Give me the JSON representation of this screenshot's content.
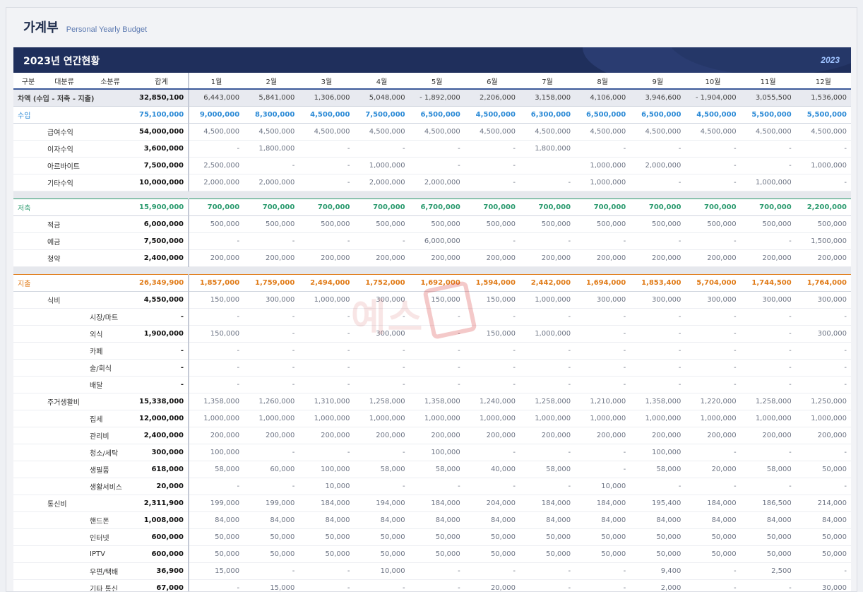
{
  "title": "가계부",
  "subtitle": "Personal Yearly Budget",
  "banner": {
    "title": "2023년 연간현황",
    "year": "2023"
  },
  "watermark": "예스",
  "colors": {
    "banner": "#1f2f5c",
    "income": "#2b8ad6",
    "saving": "#2a9a6e",
    "expense": "#e07b18"
  },
  "headers": [
    "구분",
    "대분류",
    "소분류",
    "합계",
    "1월",
    "2월",
    "3월",
    "4월",
    "5월",
    "6월",
    "7월",
    "8월",
    "9월",
    "10월",
    "11월",
    "12월"
  ],
  "rows": [
    {
      "kind": "balance",
      "l1": "차액 (수입 - 저축 - 지출)",
      "l2": "",
      "l3": "",
      "total": "32,850,100",
      "months": [
        "6,443,000",
        "5,841,000",
        "1,306,000",
        "5,048,000",
        "- 1,892,000",
        "2,206,000",
        "3,158,000",
        "4,106,000",
        "3,946,600",
        "- 1,904,000",
        "3,055,500",
        "1,536,000"
      ]
    },
    {
      "kind": "sec-income",
      "l1": "수입",
      "l2": "",
      "l3": "",
      "total": "75,100,000",
      "months": [
        "9,000,000",
        "8,300,000",
        "4,500,000",
        "7,500,000",
        "6,500,000",
        "4,500,000",
        "6,300,000",
        "6,500,000",
        "6,500,000",
        "4,500,000",
        "5,500,000",
        "5,500,000"
      ]
    },
    {
      "kind": "item",
      "l1": "",
      "l2": "급여수익",
      "l3": "",
      "total": "54,000,000",
      "months": [
        "4,500,000",
        "4,500,000",
        "4,500,000",
        "4,500,000",
        "4,500,000",
        "4,500,000",
        "4,500,000",
        "4,500,000",
        "4,500,000",
        "4,500,000",
        "4,500,000",
        "4,500,000"
      ]
    },
    {
      "kind": "item",
      "l1": "",
      "l2": "이자수익",
      "l3": "",
      "total": "3,600,000",
      "months": [
        "-",
        "1,800,000",
        "-",
        "-",
        "-",
        "-",
        "1,800,000",
        "-",
        "-",
        "-",
        "-",
        "-"
      ]
    },
    {
      "kind": "item",
      "l1": "",
      "l2": "아르바이트",
      "l3": "",
      "total": "7,500,000",
      "months": [
        "2,500,000",
        "-",
        "-",
        "1,000,000",
        "-",
        "-",
        "",
        "1,000,000",
        "2,000,000",
        "-",
        "-",
        "1,000,000"
      ]
    },
    {
      "kind": "item",
      "l1": "",
      "l2": "기타수익",
      "l3": "",
      "total": "10,000,000",
      "months": [
        "2,000,000",
        "2,000,000",
        "-",
        "2,000,000",
        "2,000,000",
        "-",
        "-",
        "1,000,000",
        "-",
        "-",
        "1,000,000",
        "-"
      ]
    },
    {
      "kind": "gap"
    },
    {
      "kind": "sec-saving",
      "l1": "저축",
      "l2": "",
      "l3": "",
      "total": "15,900,000",
      "months": [
        "700,000",
        "700,000",
        "700,000",
        "700,000",
        "6,700,000",
        "700,000",
        "700,000",
        "700,000",
        "700,000",
        "700,000",
        "700,000",
        "2,200,000"
      ]
    },
    {
      "kind": "item",
      "l1": "",
      "l2": "적금",
      "l3": "",
      "total": "6,000,000",
      "months": [
        "500,000",
        "500,000",
        "500,000",
        "500,000",
        "500,000",
        "500,000",
        "500,000",
        "500,000",
        "500,000",
        "500,000",
        "500,000",
        "500,000"
      ]
    },
    {
      "kind": "item",
      "l1": "",
      "l2": "예금",
      "l3": "",
      "total": "7,500,000",
      "months": [
        "-",
        "-",
        "-",
        "-",
        "6,000,000",
        "-",
        "-",
        "-",
        "-",
        "-",
        "-",
        "1,500,000"
      ]
    },
    {
      "kind": "item",
      "l1": "",
      "l2": "청약",
      "l3": "",
      "total": "2,400,000",
      "months": [
        "200,000",
        "200,000",
        "200,000",
        "200,000",
        "200,000",
        "200,000",
        "200,000",
        "200,000",
        "200,000",
        "200,000",
        "200,000",
        "200,000"
      ]
    },
    {
      "kind": "gap"
    },
    {
      "kind": "sec-expense",
      "l1": "지출",
      "l2": "",
      "l3": "",
      "total": "26,349,900",
      "months": [
        "1,857,000",
        "1,759,000",
        "2,494,000",
        "1,752,000",
        "1,692,000",
        "1,594,000",
        "2,442,000",
        "1,694,000",
        "1,853,400",
        "5,704,000",
        "1,744,500",
        "1,764,000"
      ]
    },
    {
      "kind": "grp",
      "l1": "",
      "l2": "식비",
      "l3": "",
      "total": "4,550,000",
      "months": [
        "150,000",
        "300,000",
        "1,000,000",
        "300,000",
        "150,000",
        "150,000",
        "1,000,000",
        "300,000",
        "300,000",
        "300,000",
        "300,000",
        "300,000"
      ]
    },
    {
      "kind": "sub",
      "l1": "",
      "l2": "",
      "l3": "시장/마트",
      "total": "-",
      "months": [
        "-",
        "-",
        "-",
        "-",
        "-",
        "-",
        "-",
        "-",
        "-",
        "-",
        "-",
        "-"
      ]
    },
    {
      "kind": "sub",
      "l1": "",
      "l2": "",
      "l3": "외식",
      "total": "1,900,000",
      "months": [
        "150,000",
        "-",
        "-",
        "300,000",
        "-",
        "150,000",
        "1,000,000",
        "-",
        "-",
        "-",
        "-",
        "300,000"
      ]
    },
    {
      "kind": "sub",
      "l1": "",
      "l2": "",
      "l3": "카페",
      "total": "-",
      "months": [
        "-",
        "-",
        "-",
        "-",
        "-",
        "-",
        "-",
        "-",
        "-",
        "-",
        "-",
        "-"
      ]
    },
    {
      "kind": "sub",
      "l1": "",
      "l2": "",
      "l3": "술/회식",
      "total": "-",
      "months": [
        "-",
        "-",
        "-",
        "-",
        "-",
        "-",
        "-",
        "-",
        "-",
        "-",
        "-",
        "-"
      ]
    },
    {
      "kind": "sub",
      "l1": "",
      "l2": "",
      "l3": "배달",
      "total": "-",
      "months": [
        "-",
        "-",
        "-",
        "-",
        "-",
        "-",
        "-",
        "-",
        "-",
        "-",
        "-",
        "-"
      ]
    },
    {
      "kind": "grp",
      "l1": "",
      "l2": "주거생활비",
      "l3": "",
      "total": "15,338,000",
      "months": [
        "1,358,000",
        "1,260,000",
        "1,310,000",
        "1,258,000",
        "1,358,000",
        "1,240,000",
        "1,258,000",
        "1,210,000",
        "1,358,000",
        "1,220,000",
        "1,258,000",
        "1,250,000"
      ]
    },
    {
      "kind": "sub",
      "l1": "",
      "l2": "",
      "l3": "집세",
      "total": "12,000,000",
      "months": [
        "1,000,000",
        "1,000,000",
        "1,000,000",
        "1,000,000",
        "1,000,000",
        "1,000,000",
        "1,000,000",
        "1,000,000",
        "1,000,000",
        "1,000,000",
        "1,000,000",
        "1,000,000"
      ]
    },
    {
      "kind": "sub",
      "l1": "",
      "l2": "",
      "l3": "관리비",
      "total": "2,400,000",
      "months": [
        "200,000",
        "200,000",
        "200,000",
        "200,000",
        "200,000",
        "200,000",
        "200,000",
        "200,000",
        "200,000",
        "200,000",
        "200,000",
        "200,000"
      ]
    },
    {
      "kind": "sub",
      "l1": "",
      "l2": "",
      "l3": "청소/세탁",
      "total": "300,000",
      "months": [
        "100,000",
        "-",
        "-",
        "-",
        "100,000",
        "-",
        "-",
        "-",
        "100,000",
        "-",
        "-",
        "-"
      ]
    },
    {
      "kind": "sub",
      "l1": "",
      "l2": "",
      "l3": "생필품",
      "total": "618,000",
      "months": [
        "58,000",
        "60,000",
        "100,000",
        "58,000",
        "58,000",
        "40,000",
        "58,000",
        "-",
        "58,000",
        "20,000",
        "58,000",
        "50,000"
      ]
    },
    {
      "kind": "sub",
      "l1": "",
      "l2": "",
      "l3": "생활서비스",
      "total": "20,000",
      "months": [
        "-",
        "-",
        "10,000",
        "-",
        "-",
        "-",
        "-",
        "10,000",
        "-",
        "-",
        "-",
        "-"
      ]
    },
    {
      "kind": "grp",
      "l1": "",
      "l2": "통신비",
      "l3": "",
      "total": "2,311,900",
      "months": [
        "199,000",
        "199,000",
        "184,000",
        "194,000",
        "184,000",
        "204,000",
        "184,000",
        "184,000",
        "195,400",
        "184,000",
        "186,500",
        "214,000"
      ]
    },
    {
      "kind": "sub",
      "l1": "",
      "l2": "",
      "l3": "핸드폰",
      "total": "1,008,000",
      "months": [
        "84,000",
        "84,000",
        "84,000",
        "84,000",
        "84,000",
        "84,000",
        "84,000",
        "84,000",
        "84,000",
        "84,000",
        "84,000",
        "84,000"
      ]
    },
    {
      "kind": "sub",
      "l1": "",
      "l2": "",
      "l3": "인터넷",
      "total": "600,000",
      "months": [
        "50,000",
        "50,000",
        "50,000",
        "50,000",
        "50,000",
        "50,000",
        "50,000",
        "50,000",
        "50,000",
        "50,000",
        "50,000",
        "50,000"
      ]
    },
    {
      "kind": "sub",
      "l1": "",
      "l2": "",
      "l3": "IPTV",
      "total": "600,000",
      "months": [
        "50,000",
        "50,000",
        "50,000",
        "50,000",
        "50,000",
        "50,000",
        "50,000",
        "50,000",
        "50,000",
        "50,000",
        "50,000",
        "50,000"
      ]
    },
    {
      "kind": "sub",
      "l1": "",
      "l2": "",
      "l3": "우편/택배",
      "total": "36,900",
      "months": [
        "15,000",
        "-",
        "-",
        "10,000",
        "-",
        "-",
        "-",
        "-",
        "9,400",
        "-",
        "2,500",
        "-"
      ]
    },
    {
      "kind": "sub",
      "l1": "",
      "l2": "",
      "l3": "기타 통신",
      "total": "67,000",
      "months": [
        "-",
        "15,000",
        "-",
        "-",
        "-",
        "20,000",
        "-",
        "-",
        "2,000",
        "-",
        "-",
        "30,000"
      ]
    }
  ]
}
